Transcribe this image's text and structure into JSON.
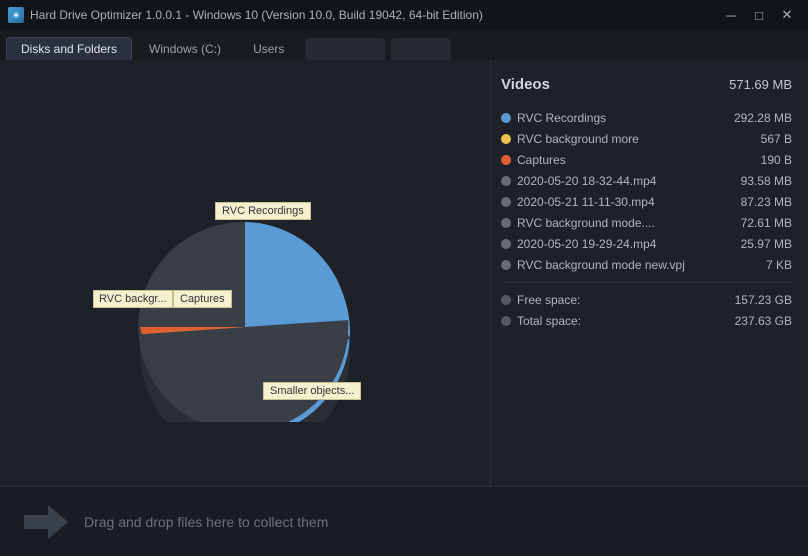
{
  "titleBar": {
    "title": "Hard Drive Optimizer 1.0.0.1 - Windows 10 (Version 10.0, Build 19042, 64-bit Edition)",
    "minBtn": "─",
    "maxBtn": "□",
    "closeBtn": "✕"
  },
  "nav": {
    "tabs": [
      {
        "label": "Disks and Folders",
        "active": true
      },
      {
        "label": "Windows (C:)",
        "active": false
      },
      {
        "label": "Users",
        "active": false
      }
    ]
  },
  "rightPanel": {
    "title": "Videos",
    "totalSize": "571.69 MB",
    "items": [
      {
        "color": "#5b9bd5",
        "name": "RVC Recordings",
        "size": "292.28 MB"
      },
      {
        "color": "#f0c050",
        "name": "RVC background more",
        "size": "567 B"
      },
      {
        "color": "#e06030",
        "name": "Captures",
        "size": "190 B"
      },
      {
        "color": "#666b74",
        "name": "2020-05-20 18-32-44.mp4",
        "size": "93.58 MB"
      },
      {
        "color": "#666b74",
        "name": "2020-05-21 11-11-30.mp4",
        "size": "87.23 MB"
      },
      {
        "color": "#666b74",
        "name": "RVC background mode....",
        "size": "72.61 MB"
      },
      {
        "color": "#666b74",
        "name": "2020-05-20 19-29-24.mp4",
        "size": "25.97 MB"
      },
      {
        "color": "#666b74",
        "name": "RVC background mode new.vpj",
        "size": "7 KB"
      }
    ],
    "freeSpace": {
      "label": "Free space:",
      "value": "157.23 GB"
    },
    "totalSpace": {
      "label": "Total space:",
      "value": "237.63 GB"
    }
  },
  "chart": {
    "tooltip1": "RVC Recordings",
    "tooltip2": "RVC backgr...",
    "tooltip3": "Captures",
    "tooltip4": "Smaller objects..."
  },
  "dropZone": {
    "text": "Drag and drop files here to collect them"
  }
}
